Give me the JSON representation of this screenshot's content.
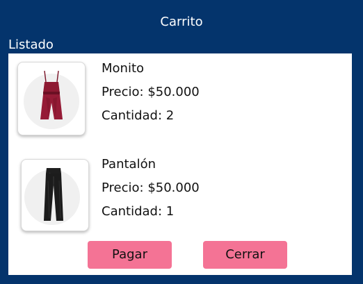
{
  "header": {
    "title": "Carrito"
  },
  "list": {
    "label": "Listado"
  },
  "items": [
    {
      "name": "Monito",
      "price": "Precio: $50.000",
      "quantity": "Cantidad: 2",
      "image_icon": "jumpsuit-icon"
    },
    {
      "name": "Pantalón",
      "price": "Precio: $50.000",
      "quantity": "Cantidad: 1",
      "image_icon": "pants-icon"
    }
  ],
  "actions": {
    "pay_label": "Pagar",
    "close_label": "Cerrar"
  },
  "colors": {
    "background": "#04346c",
    "panel": "#ffffff",
    "button": "#f47395"
  }
}
